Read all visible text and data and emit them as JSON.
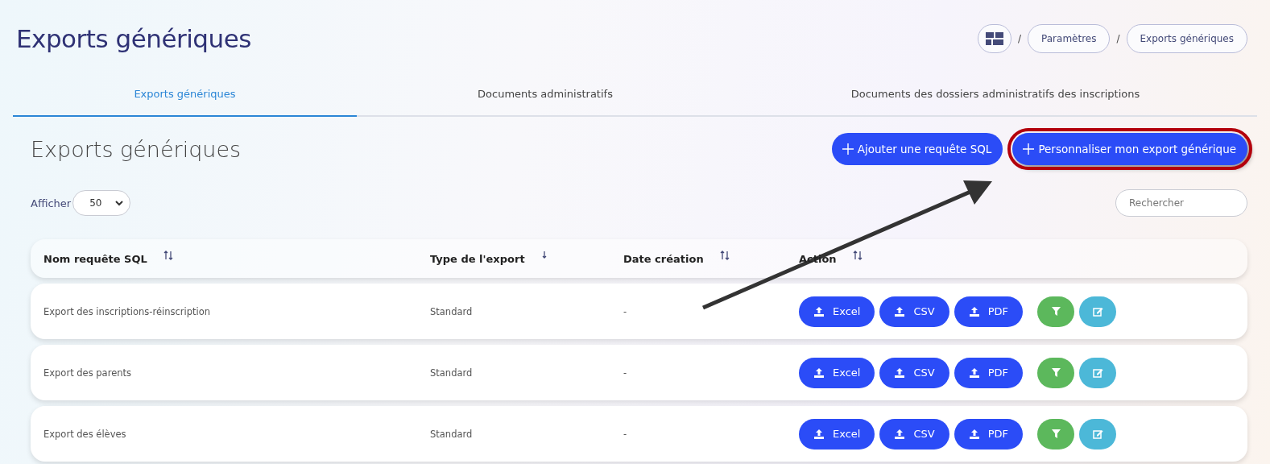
{
  "page": {
    "title": "Exports génériques"
  },
  "breadcrumb": [
    {
      "separator": "/",
      "label": "Paramètres"
    },
    {
      "separator": "/",
      "label": "Exports génériques"
    }
  ],
  "tabs": [
    {
      "label": "Exports génériques",
      "selected": true
    },
    {
      "label": "Documents administratifs",
      "selected": false
    },
    {
      "label": "Documents des dossiers administratifs des inscriptions",
      "selected": false
    }
  ],
  "section": {
    "title": "Exports génériques"
  },
  "buttons": [
    {
      "label": "Ajouter une requête SQL",
      "highlighted": false
    },
    {
      "label": "Personnaliser mon export générique",
      "highlighted": true
    }
  ],
  "length_control": {
    "label": "Afficher",
    "value": "50"
  },
  "search": {
    "placeholder": "Rechercher"
  },
  "table": {
    "columns": [
      {
        "label": "Nom requête SQL",
        "sorted": false
      },
      {
        "label": "Type de l'export",
        "sorted": true
      },
      {
        "label": "Date création",
        "sorted": false
      },
      {
        "label": "Action",
        "sorted": false
      }
    ],
    "rows": [
      {
        "name": "Export des inscriptions-réinscription",
        "type": "Standard",
        "date": "-",
        "exports": [
          "Excel",
          "CSV",
          "PDF"
        ]
      },
      {
        "name": "Export des parents",
        "type": "Standard",
        "date": "-",
        "exports": [
          "Excel",
          "CSV",
          "PDF"
        ]
      },
      {
        "name": "Export des élèves",
        "type": "Standard",
        "date": "-",
        "exports": [
          "Excel",
          "CSV",
          "PDF"
        ]
      }
    ]
  }
}
